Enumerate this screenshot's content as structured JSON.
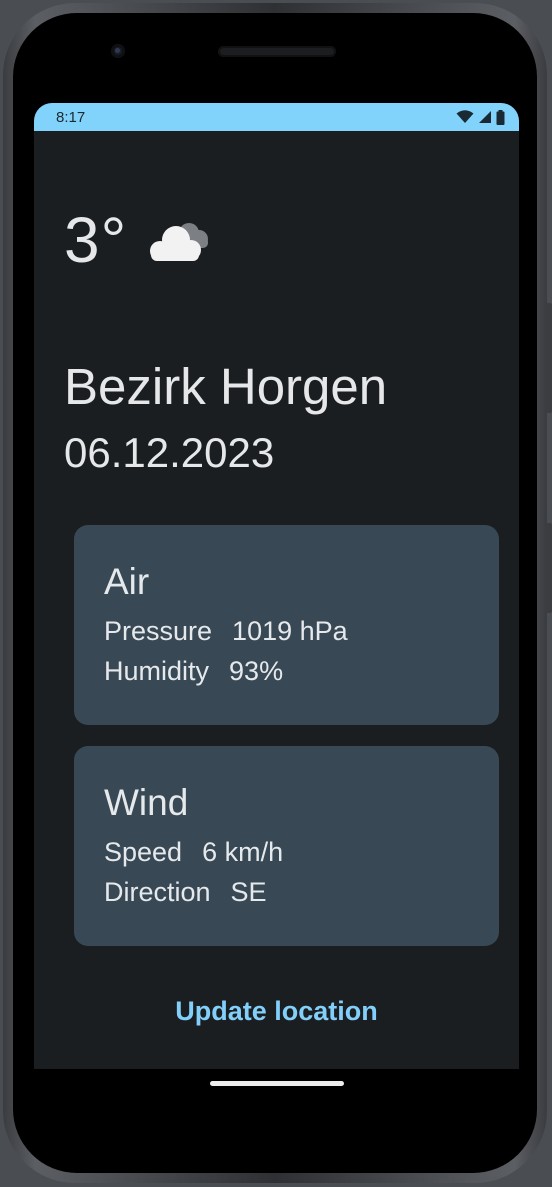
{
  "status_bar": {
    "time": "8:17",
    "icons": [
      "wifi-icon",
      "cellular-signal-icon",
      "battery-icon"
    ]
  },
  "weather": {
    "temperature": "3°",
    "condition_icon": "cloud-icon",
    "location": "Bezirk Horgen",
    "date": "06.12.2023"
  },
  "air": {
    "title": "Air",
    "pressure_label": "Pressure",
    "pressure_value": "1019 hPa",
    "humidity_label": "Humidity",
    "humidity_value": "93%"
  },
  "wind": {
    "title": "Wind",
    "speed_label": "Speed",
    "speed_value": "6 km/h",
    "direction_label": "Direction",
    "direction_value": "SE"
  },
  "actions": {
    "update_location_label": "Update location"
  },
  "colors": {
    "status_bar": "#82d3fc",
    "background": "#1b1e21",
    "card": "#384955",
    "accent": "#82cffa",
    "text": "#e6e7e8"
  }
}
